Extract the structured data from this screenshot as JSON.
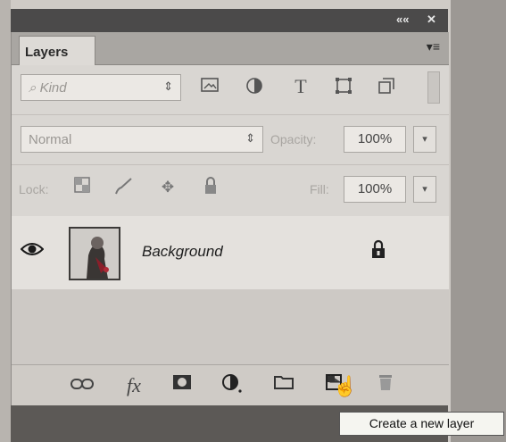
{
  "window": {
    "collapse_label": "««",
    "close_label": "✕"
  },
  "panel": {
    "tab_label": "Layers",
    "menu_label": "▾≡"
  },
  "filter": {
    "kind_label": "Kind",
    "icons": [
      "image-filter-icon",
      "adjustment-filter-icon",
      "type-filter-icon",
      "shape-filter-icon",
      "smart-object-filter-icon"
    ]
  },
  "blend": {
    "mode": "Normal",
    "opacity_label": "Opacity:",
    "opacity_value": "100%"
  },
  "locks": {
    "lock_label": "Lock:",
    "fill_label": "Fill:",
    "fill_value": "100%"
  },
  "layers": [
    {
      "name": "Background",
      "visible": true,
      "locked": true
    }
  ],
  "footer": {
    "icons": [
      "link-layers-icon",
      "fx-icon",
      "layer-mask-icon",
      "adjustment-layer-icon",
      "group-folder-icon",
      "new-layer-icon",
      "trash-icon"
    ],
    "fx_label": "fx"
  },
  "tooltip": {
    "text": "Create a new layer"
  },
  "colors": {
    "panel_bg": "#d9d6d2",
    "frame_dark": "#4b4a4a",
    "tooltip_bg": "#f5f5f0"
  }
}
